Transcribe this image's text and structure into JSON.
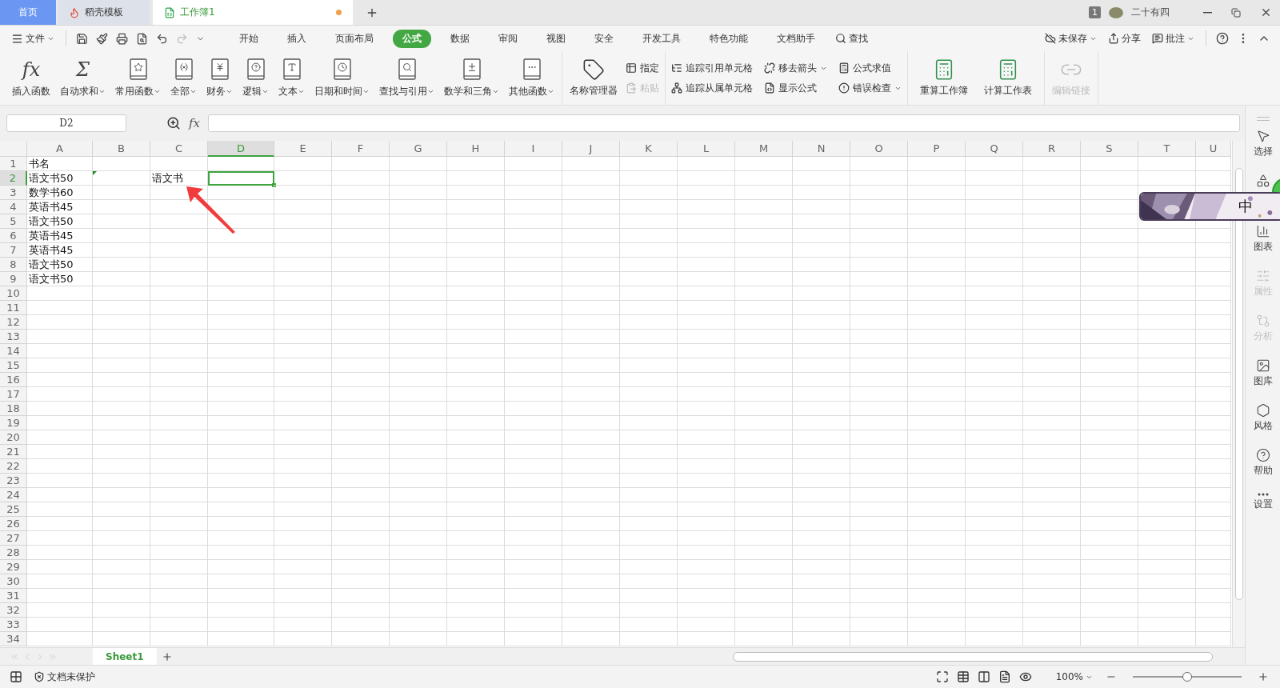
{
  "tabs": [
    {
      "label": "首页",
      "kind": "home",
      "selected": false
    },
    {
      "label": "稻壳模板",
      "kind": "template",
      "selected": false
    },
    {
      "label": "工作簿1",
      "kind": "sheet",
      "selected": true,
      "unsaved": true
    }
  ],
  "title_bar": {
    "badge": "1",
    "user": "二十有四"
  },
  "file_menu": "文件",
  "quick_tools": [
    {
      "kind": "save",
      "disabled": false
    },
    {
      "kind": "painter",
      "disabled": false
    },
    {
      "kind": "print",
      "disabled": false
    },
    {
      "kind": "preview",
      "disabled": false
    },
    {
      "kind": "undo",
      "disabled": false
    },
    {
      "kind": "redo",
      "disabled": true
    },
    {
      "kind": "more",
      "disabled": false
    }
  ],
  "menu_tabs": [
    {
      "label": "开始",
      "selected": false
    },
    {
      "label": "插入",
      "selected": false
    },
    {
      "label": "页面布局",
      "selected": false
    },
    {
      "label": "公式",
      "selected": true
    },
    {
      "label": "数据",
      "selected": false
    },
    {
      "label": "审阅",
      "selected": false
    },
    {
      "label": "视图",
      "selected": false
    },
    {
      "label": "安全",
      "selected": false
    },
    {
      "label": "开发工具",
      "selected": false
    },
    {
      "label": "特色功能",
      "selected": false
    },
    {
      "label": "文档助手",
      "selected": false
    }
  ],
  "find": "查找",
  "right_actions": [
    {
      "label": "未保存",
      "kind": "cloud",
      "dropdown": true
    },
    {
      "label": "分享",
      "kind": "share",
      "dropdown": false
    },
    {
      "label": "批注",
      "kind": "comment",
      "dropdown": true
    }
  ],
  "ribbon": {
    "functions": [
      {
        "label": "插入函数",
        "kind": "glyph",
        "glyph": "fx",
        "dropdown": false
      },
      {
        "label": "自动求和",
        "kind": "glyph",
        "glyph": "Σ",
        "dropdown": true
      },
      {
        "label": "常用函数",
        "kind": "star",
        "dropdown": true
      },
      {
        "label": "全部",
        "kind": "formula",
        "dropdown": true
      },
      {
        "label": "财务",
        "kind": "money",
        "dropdown": true
      },
      {
        "label": "逻辑",
        "kind": "question",
        "dropdown": true
      },
      {
        "label": "文本",
        "kind": "letter",
        "dropdown": true
      },
      {
        "label": "日期和时间",
        "kind": "clock",
        "dropdown": true
      },
      {
        "label": "查找与引用",
        "kind": "search",
        "dropdown": true
      },
      {
        "label": "数学和三角",
        "kind": "math",
        "dropdown": true
      },
      {
        "label": "其他函数",
        "kind": "dots",
        "dropdown": true
      }
    ],
    "name_manager": "名称管理器",
    "name_tools": [
      {
        "label": "指定",
        "disabled": false
      },
      {
        "label": "粘贴",
        "disabled": true
      }
    ],
    "audit_tools": [
      {
        "label": "追踪引用单元格",
        "kind": "precedents",
        "dropdown": false
      },
      {
        "label": "追踪从属单元格",
        "kind": "dependents",
        "dropdown": false
      },
      {
        "label": "移去箭头",
        "kind": "remove",
        "dropdown": true
      },
      {
        "label": "显示公式",
        "kind": "show",
        "dropdown": false
      },
      {
        "label": "公式求值",
        "kind": "evaluate",
        "dropdown": false
      },
      {
        "label": "错误检查",
        "kind": "check",
        "dropdown": true
      }
    ],
    "calc_tools": [
      {
        "label": "重算工作簿"
      },
      {
        "label": "计算工作表"
      }
    ],
    "edit_links": {
      "label": "编辑链接",
      "disabled": true
    }
  },
  "formula_bar": {
    "cell": "D2",
    "fx": "fx"
  },
  "grid": {
    "columns": [
      {
        "label": "A",
        "selected": false
      },
      {
        "label": "B",
        "selected": false
      },
      {
        "label": "C",
        "selected": false
      },
      {
        "label": "D",
        "selected": true
      },
      {
        "label": "E",
        "selected": false
      },
      {
        "label": "F",
        "selected": false
      },
      {
        "label": "G",
        "selected": false
      },
      {
        "label": "H",
        "selected": false
      },
      {
        "label": "I",
        "selected": false
      },
      {
        "label": "J",
        "selected": false
      },
      {
        "label": "K",
        "selected": false
      },
      {
        "label": "L",
        "selected": false
      },
      {
        "label": "M",
        "selected": false
      },
      {
        "label": "N",
        "selected": false
      },
      {
        "label": "O",
        "selected": false
      },
      {
        "label": "P",
        "selected": false
      },
      {
        "label": "Q",
        "selected": false
      },
      {
        "label": "R",
        "selected": false
      },
      {
        "label": "S",
        "selected": false
      },
      {
        "label": "T",
        "selected": false
      },
      {
        "label": "U",
        "selected": false
      }
    ],
    "rows": [
      {
        "label": "1",
        "selected": false,
        "cells": [
          {
            "text": "书名"
          }
        ]
      },
      {
        "label": "2",
        "selected": true,
        "cells": [
          {
            "text": "语文书50"
          },
          {
            "flagged": true
          },
          {
            "text": "语文书"
          }
        ]
      },
      {
        "label": "3",
        "selected": false,
        "cells": [
          {
            "text": "数学书60"
          }
        ]
      },
      {
        "label": "4",
        "selected": false,
        "cells": [
          {
            "text": "英语书45"
          }
        ]
      },
      {
        "label": "5",
        "selected": false,
        "cells": [
          {
            "text": "语文书50"
          }
        ]
      },
      {
        "label": "6",
        "selected": false,
        "cells": [
          {
            "text": "英语书45"
          }
        ]
      },
      {
        "label": "7",
        "selected": false,
        "cells": [
          {
            "text": "英语书45"
          }
        ]
      },
      {
        "label": "8",
        "selected": false,
        "cells": [
          {
            "text": "语文书50"
          }
        ]
      },
      {
        "label": "9",
        "selected": false,
        "cells": [
          {
            "text": "语文书50"
          }
        ]
      },
      {
        "label": "10",
        "selected": false
      },
      {
        "label": "11",
        "selected": false
      },
      {
        "label": "12",
        "selected": false
      },
      {
        "label": "13",
        "selected": false
      },
      {
        "label": "14",
        "selected": false
      },
      {
        "label": "15",
        "selected": false
      },
      {
        "label": "16",
        "selected": false
      },
      {
        "label": "17",
        "selected": false
      },
      {
        "label": "18",
        "selected": false
      },
      {
        "label": "19",
        "selected": false
      },
      {
        "label": "20",
        "selected": false
      },
      {
        "label": "21",
        "selected": false
      },
      {
        "label": "22",
        "selected": false
      },
      {
        "label": "23",
        "selected": false
      },
      {
        "label": "24",
        "selected": false
      },
      {
        "label": "25",
        "selected": false
      },
      {
        "label": "26",
        "selected": false
      },
      {
        "label": "27",
        "selected": false
      },
      {
        "label": "28",
        "selected": false
      },
      {
        "label": "29",
        "selected": false
      },
      {
        "label": "30",
        "selected": false
      },
      {
        "label": "31",
        "selected": false
      },
      {
        "label": "32",
        "selected": false
      },
      {
        "label": "33",
        "selected": false
      },
      {
        "label": "34",
        "selected": false
      }
    ]
  },
  "sheets": [
    {
      "label": "Sheet1",
      "selected": true
    }
  ],
  "sidebar": [
    {
      "label": "选择",
      "kind": "select",
      "disabled": false
    },
    {
      "kind": "shapes",
      "disabled": false
    },
    {
      "label": "图表",
      "kind": "chart",
      "disabled": false
    },
    {
      "label": "属性",
      "kind": "props",
      "disabled": true
    },
    {
      "label": "分析",
      "kind": "analyze",
      "disabled": true
    },
    {
      "label": "图库",
      "kind": "gallery",
      "disabled": false
    },
    {
      "label": "风格",
      "kind": "style",
      "disabled": false
    },
    {
      "label": "帮助",
      "kind": "help",
      "disabled": false
    },
    {
      "label": "设置",
      "kind": "settings",
      "disabled": false
    }
  ],
  "status": {
    "protection": "文档未保护",
    "zoom": "100%",
    "level": 0.5
  },
  "ime": {
    "label": "中"
  }
}
